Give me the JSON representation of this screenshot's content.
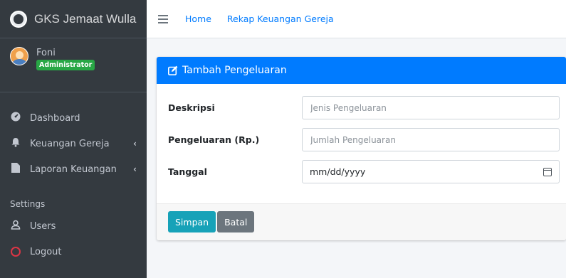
{
  "app": {
    "brand": "GKS Jemaat Wulla"
  },
  "user": {
    "name": "Foni",
    "role": "Administrator"
  },
  "sidebar": {
    "items": [
      {
        "label": "Dashboard",
        "icon": "tachometer-icon"
      },
      {
        "label": "Keuangan Gereja",
        "icon": "bell-icon",
        "chevron": "‹"
      },
      {
        "label": "Laporan Keuangan",
        "icon": "file-icon",
        "chevron": "‹"
      }
    ],
    "settings_header": "Settings",
    "settings_items": [
      {
        "label": "Users",
        "icon": "user-icon"
      },
      {
        "label": "Logout",
        "icon": "circle-icon"
      }
    ]
  },
  "topbar": {
    "links": [
      "Home",
      "Rekap Keuangan Gereja"
    ]
  },
  "form": {
    "title": "Tambah Pengeluaran",
    "fields": [
      {
        "label": "Deskripsi",
        "placeholder": "Jenis Pengeluaran"
      },
      {
        "label": "Pengeluaran (Rp.)",
        "placeholder": "Jumlah Pengeluaran"
      },
      {
        "label": "Tanggal",
        "value": "mm/dd/yyyy"
      }
    ],
    "save_label": "Simpan",
    "cancel_label": "Batal"
  },
  "colors": {
    "primary": "#007bff",
    "sidebar": "#343a40",
    "success": "#28a745",
    "info": "#17a2b8",
    "secondary": "#6c757d",
    "danger": "#dc3545"
  }
}
